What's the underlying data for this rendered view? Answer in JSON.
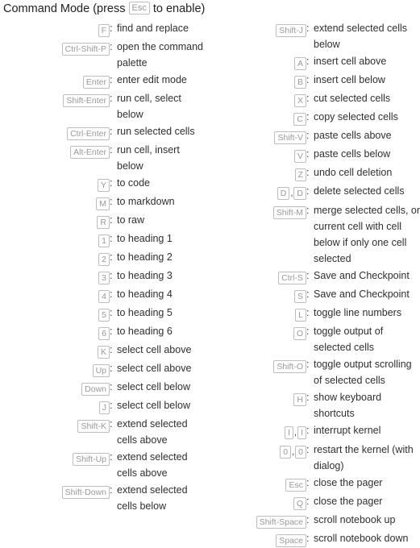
{
  "header": {
    "text_before": "Command Mode (press",
    "key": "Esc",
    "text_after": "to enable)"
  },
  "columns": {
    "left": [
      {
        "keys": [
          "F"
        ],
        "desc": "find and replace"
      },
      {
        "keys": [
          "Ctrl-Shift-P"
        ],
        "desc": "open the command palette"
      },
      {
        "keys": [
          "Enter"
        ],
        "desc": "enter edit mode"
      },
      {
        "keys": [
          "Shift-Enter"
        ],
        "desc": "run cell, select below"
      },
      {
        "keys": [
          "Ctrl-Enter"
        ],
        "desc": "run selected cells"
      },
      {
        "keys": [
          "Alt-Enter"
        ],
        "desc": "run cell, insert below"
      },
      {
        "keys": [
          "Y"
        ],
        "desc": "to code"
      },
      {
        "keys": [
          "M"
        ],
        "desc": "to markdown"
      },
      {
        "keys": [
          "R"
        ],
        "desc": "to raw"
      },
      {
        "keys": [
          "1"
        ],
        "desc": "to heading 1"
      },
      {
        "keys": [
          "2"
        ],
        "desc": "to heading 2"
      },
      {
        "keys": [
          "3"
        ],
        "desc": "to heading 3"
      },
      {
        "keys": [
          "4"
        ],
        "desc": "to heading 4"
      },
      {
        "keys": [
          "5"
        ],
        "desc": "to heading 5"
      },
      {
        "keys": [
          "6"
        ],
        "desc": "to heading 6"
      },
      {
        "keys": [
          "K"
        ],
        "desc": "select cell above"
      },
      {
        "keys": [
          "Up"
        ],
        "desc": "select cell above"
      },
      {
        "keys": [
          "Down"
        ],
        "desc": "select cell below"
      },
      {
        "keys": [
          "J"
        ],
        "desc": "select cell below"
      },
      {
        "keys": [
          "Shift-K"
        ],
        "desc": "extend selected cells above"
      },
      {
        "keys": [
          "Shift-Up"
        ],
        "desc": "extend selected cells above"
      },
      {
        "keys": [
          "Shift-Down"
        ],
        "desc": "extend selected cells below"
      }
    ],
    "right": [
      {
        "keys": [
          "Shift-J"
        ],
        "desc": "extend selected cells below"
      },
      {
        "keys": [
          "A"
        ],
        "desc": "insert cell above"
      },
      {
        "keys": [
          "B"
        ],
        "desc": "insert cell below"
      },
      {
        "keys": [
          "X"
        ],
        "desc": "cut selected cells"
      },
      {
        "keys": [
          "C"
        ],
        "desc": "copy selected cells"
      },
      {
        "keys": [
          "Shift-V"
        ],
        "desc": "paste cells above"
      },
      {
        "keys": [
          "V"
        ],
        "desc": "paste cells below"
      },
      {
        "keys": [
          "Z"
        ],
        "desc": "undo cell deletion"
      },
      {
        "keys": [
          "D",
          "D"
        ],
        "desc": "delete selected cells"
      },
      {
        "keys": [
          "Shift-M"
        ],
        "desc": "merge selected cells, or current cell with cell below if only one cell selected"
      },
      {
        "keys": [
          "Ctrl-S"
        ],
        "desc": "Save and Checkpoint"
      },
      {
        "keys": [
          "S"
        ],
        "desc": "Save and Checkpoint"
      },
      {
        "keys": [
          "L"
        ],
        "desc": "toggle line numbers"
      },
      {
        "keys": [
          "O"
        ],
        "desc": "toggle output of selected cells"
      },
      {
        "keys": [
          "Shift-O"
        ],
        "desc": "toggle output scrolling of selected cells"
      },
      {
        "keys": [
          "H"
        ],
        "desc": "show keyboard shortcuts"
      },
      {
        "keys": [
          "I",
          "I"
        ],
        "desc": "interrupt kernel"
      },
      {
        "keys": [
          "0",
          "0"
        ],
        "desc": "restart the kernel (with dialog)"
      },
      {
        "keys": [
          "Esc"
        ],
        "desc": "close the pager"
      },
      {
        "keys": [
          "Q"
        ],
        "desc": "close the pager"
      },
      {
        "keys": [
          "Shift-Space"
        ],
        "desc": "scroll notebook up"
      },
      {
        "keys": [
          "Space"
        ],
        "desc": "scroll notebook down"
      }
    ]
  },
  "separator": ":",
  "key_separator": ",",
  "colors": {
    "key_border": "#bdbdbd",
    "key_text": "#9a9a9a",
    "desc_text": "#2f2f2f",
    "background": "#ffffff"
  }
}
